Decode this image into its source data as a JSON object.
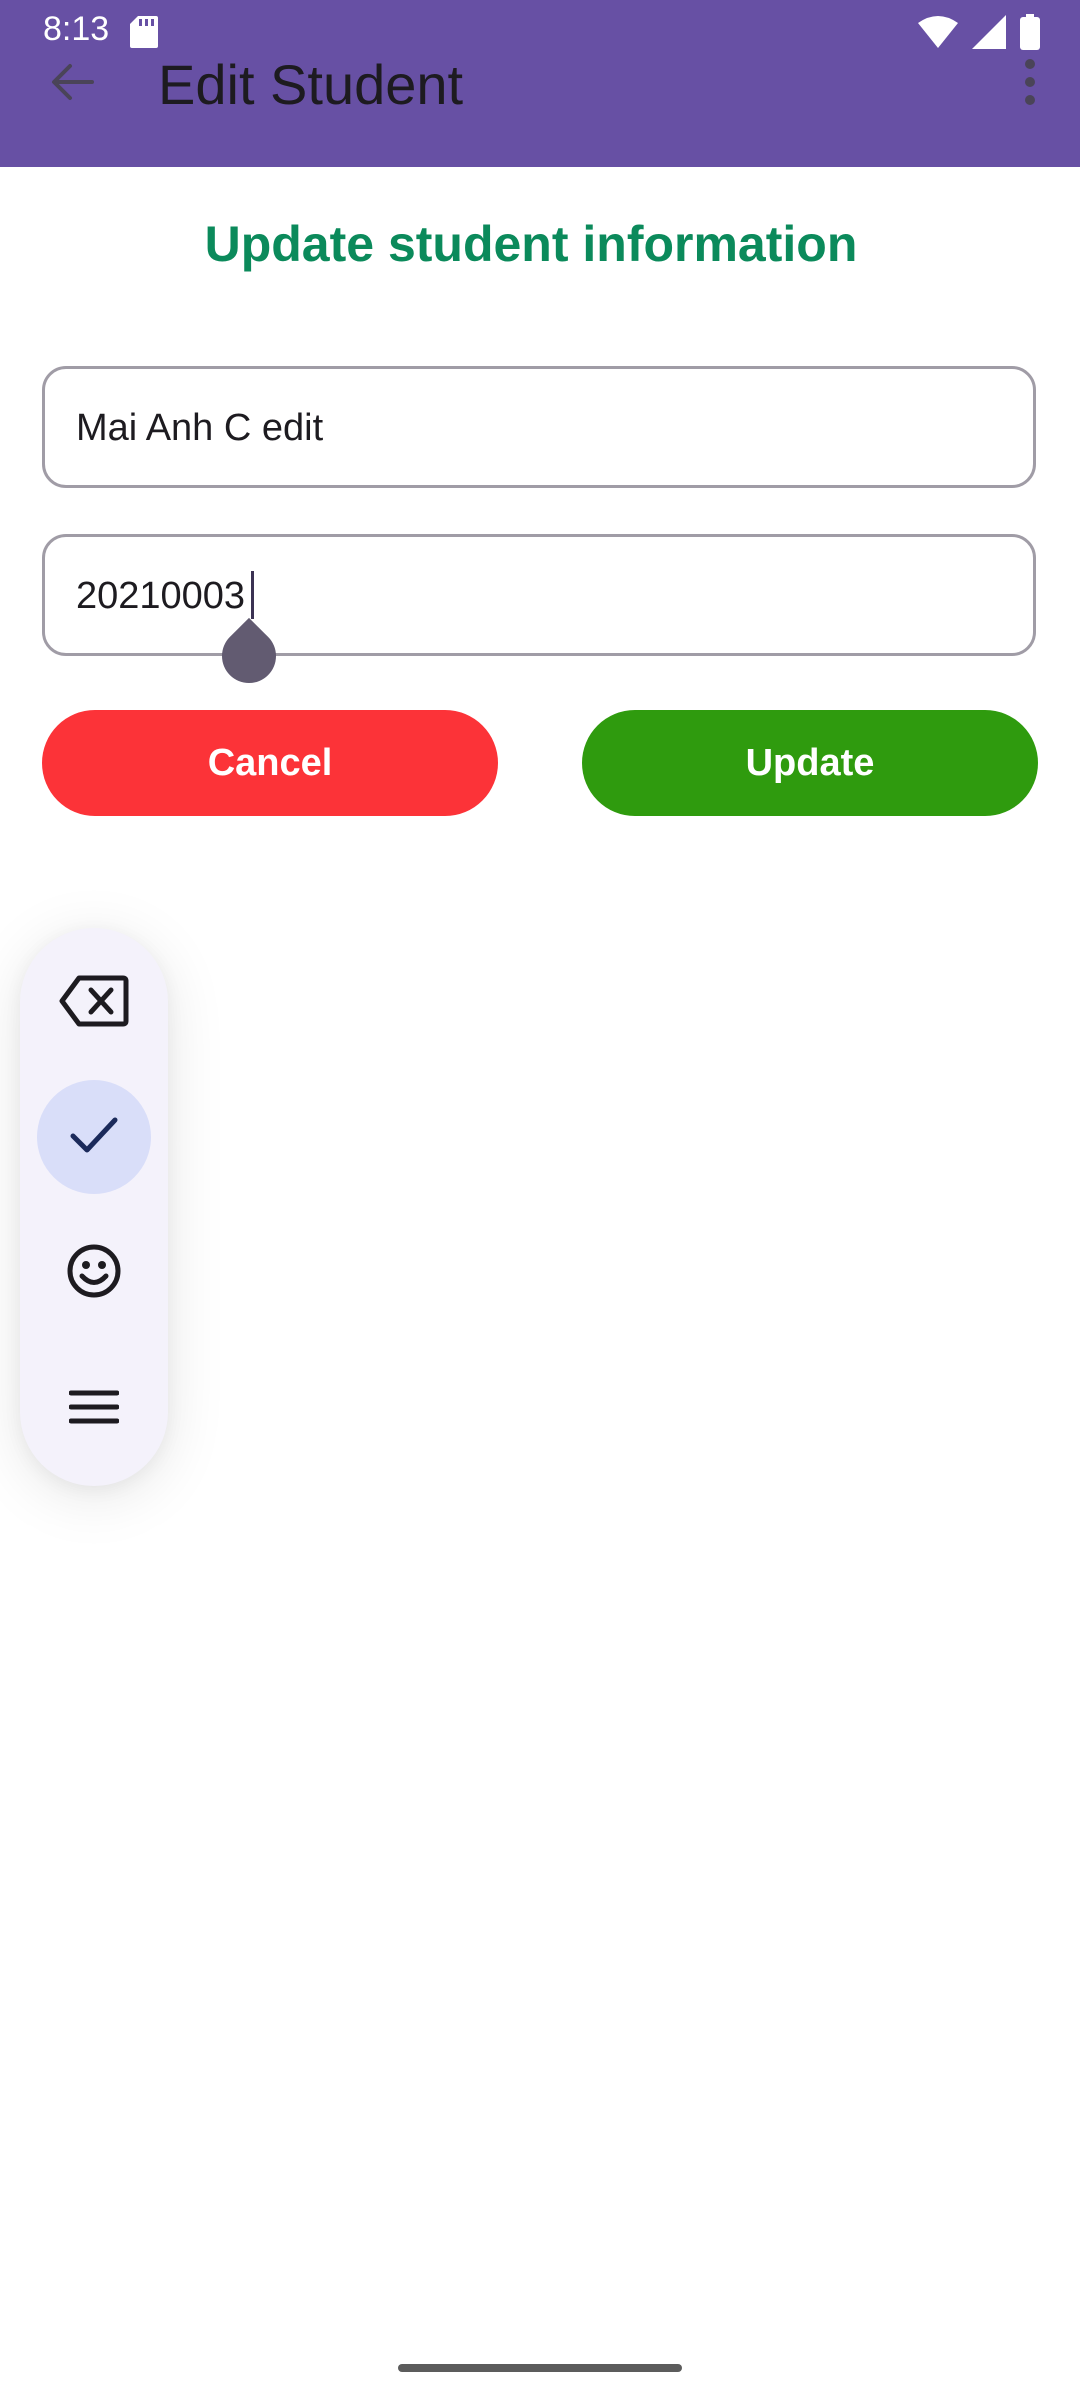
{
  "status_bar": {
    "time": "8:13",
    "icons": [
      "sd-card-icon",
      "wifi-icon",
      "signal-icon",
      "battery-icon"
    ]
  },
  "app_bar": {
    "title": "Edit Student",
    "back_icon": "arrow-back-icon",
    "menu_icon": "more-vert-icon",
    "color": "#6750a4"
  },
  "form": {
    "heading": "Update student information",
    "heading_color": "#0b8a5b",
    "name_value": "Mai Anh C edit",
    "id_value": "20210003"
  },
  "buttons": {
    "cancel_label": "Cancel",
    "cancel_color": "#fc3338",
    "update_label": "Update",
    "update_color": "#2f9b0e"
  },
  "keyboard_toolbar": {
    "items": [
      "backspace-icon",
      "check-icon",
      "emoji-icon",
      "menu-icon"
    ],
    "selected": "check-icon"
  }
}
